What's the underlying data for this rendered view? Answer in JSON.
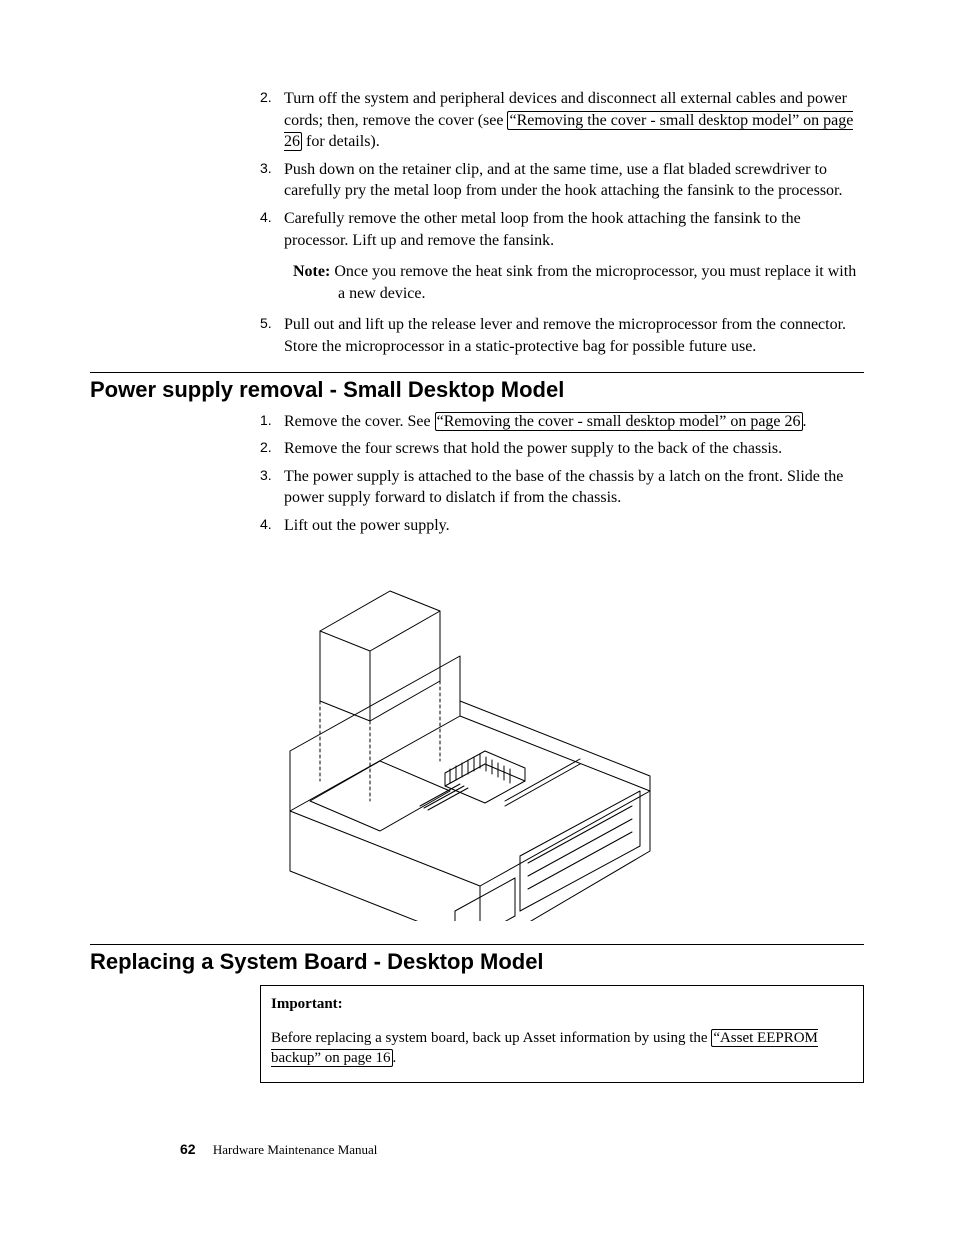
{
  "list1": {
    "item2": {
      "num": "2.",
      "before": "Turn off the system and peripheral devices and disconnect all external cables and power cords; then, remove the cover (see ",
      "link": "“Removing the cover - small desktop model” on page 26",
      "after": " for details)."
    },
    "item3": {
      "num": "3.",
      "text": "Push down on the retainer clip, and at the same time, use a flat bladed screwdriver to carefully pry the metal loop from under the hook attaching the fansink to the processor."
    },
    "item4": {
      "num": "4.",
      "text": "Carefully remove the other metal loop from the hook attaching the fansink to the processor. Lift up and remove the fansink.",
      "note_label": "Note:",
      "note_text": "Once you remove the heat sink from the microprocessor, you must replace it with a new device."
    },
    "item5": {
      "num": "5.",
      "text": "Pull out and lift up the release lever and remove the microprocessor from the connector. Store the microprocessor in a static-protective bag for possible future use."
    }
  },
  "section1": {
    "heading": "Power supply removal - Small Desktop Model",
    "item1": {
      "num": "1.",
      "before": "Remove the cover. See ",
      "link": "“Removing the cover - small desktop model” on page 26",
      "after": "."
    },
    "item2": {
      "num": "2.",
      "text": "Remove the four screws that hold the power supply to the back of the chassis."
    },
    "item3": {
      "num": "3.",
      "text": "The power supply is attached to the base of the chassis by a latch on the front. Slide the power supply forward to dislatch if from the chassis."
    },
    "item4": {
      "num": "4.",
      "text": "Lift out the power supply."
    }
  },
  "section2": {
    "heading": "Replacing a System Board - Desktop Model",
    "important_label": "Important:",
    "important_before": "Before replacing a system board, back up Asset information by using the ",
    "important_link": "“Asset EEPROM backup” on page 16",
    "important_after": "."
  },
  "footer": {
    "page": "62",
    "title": "Hardware Maintenance Manual"
  }
}
